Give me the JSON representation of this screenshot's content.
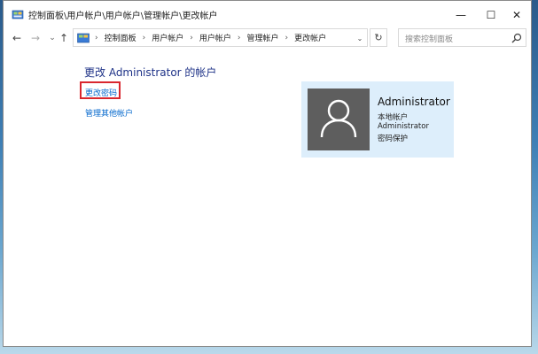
{
  "window": {
    "title": "控制面板\\用户帐户\\用户帐户\\管理帐户\\更改帐户",
    "minimize_symbol": "—",
    "maximize_symbol": "☐",
    "close_symbol": "✕"
  },
  "navigation": {
    "back_symbol": "←",
    "forward_symbol": "→",
    "recent_symbol": "⌄",
    "up_symbol": "↑",
    "breadcrumbs": [
      "控制面板",
      "用户帐户",
      "用户帐户",
      "管理帐户",
      "更改帐户"
    ],
    "breadcrumb_separator": "›",
    "dropdown_symbol": "⌄",
    "refresh_symbol": "↻",
    "search_placeholder": "搜索控制面板",
    "icons": {
      "app": "control-panel-icon",
      "address": "control-panel-icon",
      "search": "search-icon"
    }
  },
  "main": {
    "heading": "更改 Administrator 的帐户",
    "links": {
      "change_password": "更改密码",
      "manage_other": "管理其他帐户"
    },
    "highlight_color": "#d9272e",
    "link_color": "#0066cc"
  },
  "account": {
    "name": "Administrator",
    "type": "本地帐户",
    "group": "Administrator",
    "password_status": "密码保护",
    "avatar_icon": "user-icon",
    "card_color": "#ddeefb",
    "avatar_color": "#5e5e5e"
  }
}
